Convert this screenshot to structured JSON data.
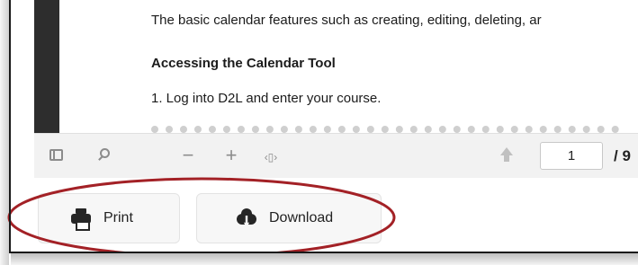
{
  "document": {
    "line1": "The basic calendar features such as creating, editing, deleting, ar",
    "heading": "Accessing the Calendar Tool",
    "line3": "1. Log into D2L and enter your course."
  },
  "toolbar": {
    "sidebar_icon": "sidebar-toggle-icon",
    "search_icon": "search-icon",
    "zoom_out_label": "−",
    "zoom_in_label": "+",
    "fit_label": "‹▯›",
    "prev_icon": "arrow-up-icon",
    "page_value": "1",
    "page_total": "/ 9"
  },
  "actions": {
    "print_label": "Print",
    "download_label": "Download"
  },
  "colors": {
    "annotation": "#a32126",
    "toolbar_bg": "#f2f2f2",
    "sidebar_dark": "#2d2d2d"
  }
}
